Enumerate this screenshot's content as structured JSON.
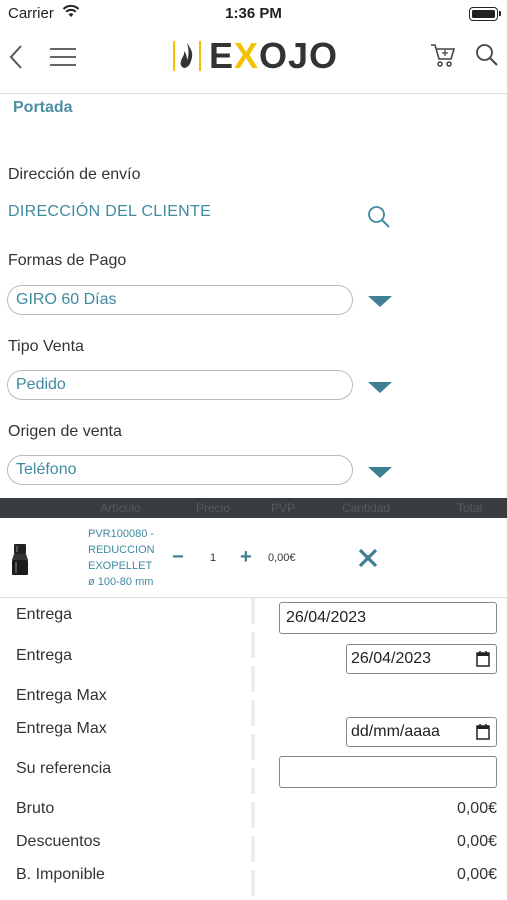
{
  "status": {
    "carrier": "Carrier",
    "time": "1:36 PM"
  },
  "nav": {
    "logo_text_pre": "E",
    "logo_text_x": "X",
    "logo_text_post": "OJO"
  },
  "breadcrumb": "Portada",
  "shipping": {
    "label": "Dirección de envío",
    "value": "DIRECCIÓN DEL CLIENTE"
  },
  "payment": {
    "label": "Formas de Pago",
    "value": "GIRO 60 Días"
  },
  "sale_type": {
    "label": "Tipo Venta",
    "value": "Pedido"
  },
  "origin": {
    "label": "Origen de venta",
    "value": "Teléfono"
  },
  "table": {
    "headers": [
      "Artículo",
      "Precio",
      "PVP",
      "Cantidad",
      "Total"
    ],
    "product": {
      "code": "PVR100080 -",
      "name_1": "REDUCCION",
      "name_2": "EXOPELLET",
      "name_3": "ø 100-80 mm",
      "quantity": "1",
      "price": "0,00€"
    }
  },
  "details": {
    "delivery_label": "Entrega",
    "delivery_text": "26/04/2023",
    "delivery_date_label": "Entrega",
    "delivery_date": "26/04/2023",
    "delivery_max_label": "Entrega Max",
    "delivery_max_date_label": "Entrega Max",
    "delivery_max_placeholder": "dd/mm/aaaa",
    "reference_label": "Su referencia",
    "reference_value": "",
    "gross_label": "Bruto",
    "gross_value": "0,00€",
    "discounts_label": "Descuentos",
    "discounts_value": "0,00€",
    "taxable_label": "B. Imponible",
    "taxable_value": "0,00€"
  },
  "colors": {
    "accent": "#3f8aa1",
    "logo_yellow": "#f2c200",
    "header_bar": "#3a3d3f"
  }
}
